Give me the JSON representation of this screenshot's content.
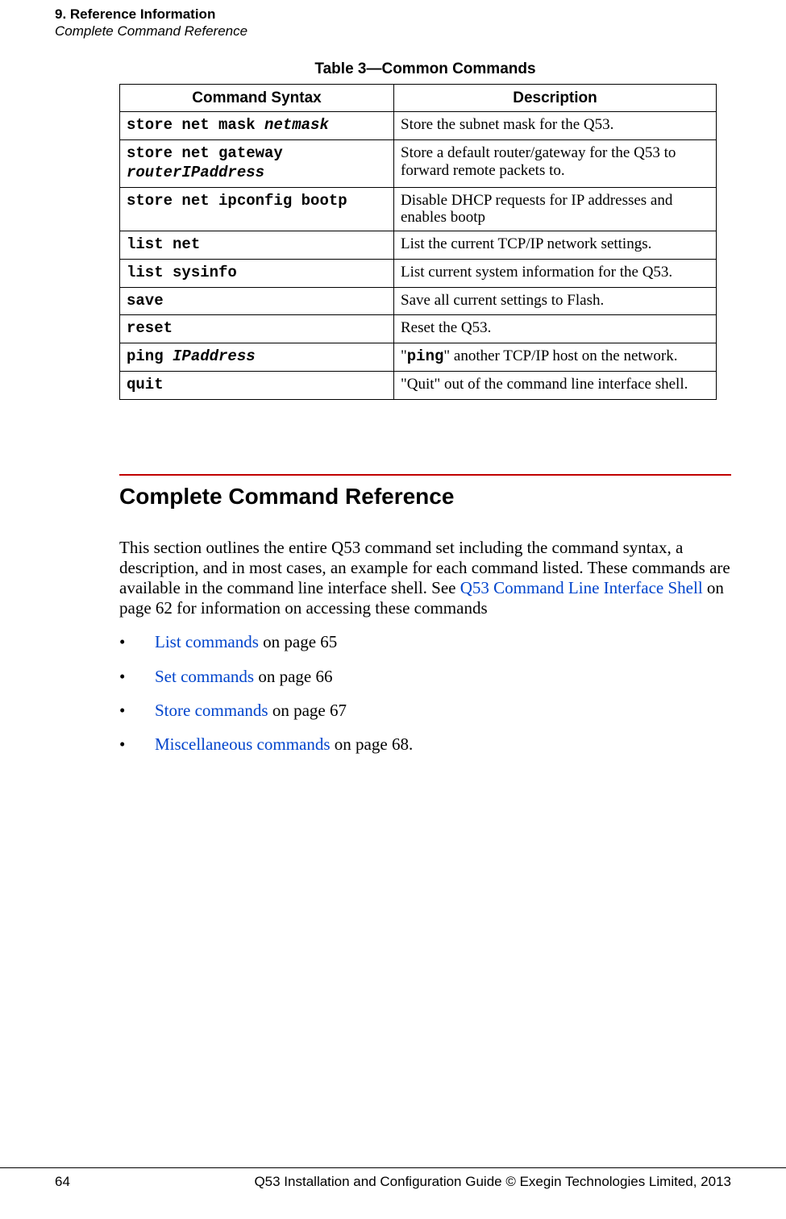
{
  "header": {
    "chapter": "9. Reference Information",
    "section": "Complete Command Reference"
  },
  "table": {
    "caption": "Table 3—Common Commands",
    "columns": {
      "syntax": "Command Syntax",
      "desc": "Description"
    },
    "rows": [
      {
        "cmd": "store net mask",
        "arg": "netmask",
        "desc": "Store the subnet mask for the Q53."
      },
      {
        "cmd": "store net gateway",
        "arg": "routerIPaddress",
        "desc": "Store a default router/gateway for the Q53 to forward remote packets to."
      },
      {
        "cmd": "store net ipconfig bootp",
        "arg": "",
        "desc": "Disable DHCP requests for IP addresses and enables bootp"
      },
      {
        "cmd": "list net",
        "arg": "",
        "desc": "List the current TCP/IP network settings."
      },
      {
        "cmd": "list sysinfo",
        "arg": "",
        "desc": "List current system information for the Q53."
      },
      {
        "cmd": "save",
        "arg": "",
        "desc": "Save all current settings to Flash."
      },
      {
        "cmd": "reset",
        "arg": "",
        "desc": "Reset the Q53."
      },
      {
        "cmd": "ping",
        "arg": "IPaddress",
        "desc_pre": "\"",
        "desc_mono": "ping",
        "desc_post": "\" another TCP/IP host on the network."
      },
      {
        "cmd": "quit",
        "arg": "",
        "desc": "\"Quit\" out of the command line interface shell."
      }
    ]
  },
  "section2": {
    "heading": "Complete Command Reference",
    "para_pre": "This section outlines the entire Q53 command set including the command syntax, a description, and in most cases, an example for each command listed. These commands are available in the command line interface shell. See ",
    "para_link": "Q53 Command Line Interface Shell",
    "para_post": " on page 62 for information on accessing these commands",
    "bullets": [
      {
        "link": "List commands",
        "text": " on page 65"
      },
      {
        "link": "Set commands",
        "text": " on page 66"
      },
      {
        "link": "Store commands",
        "text": " on page 67"
      },
      {
        "link": "Miscellaneous commands",
        "text": " on page 68."
      }
    ]
  },
  "footer": {
    "page": "64",
    "text": "Q53 Installation and Configuration Guide  © Exegin Technologies Limited, 2013"
  }
}
